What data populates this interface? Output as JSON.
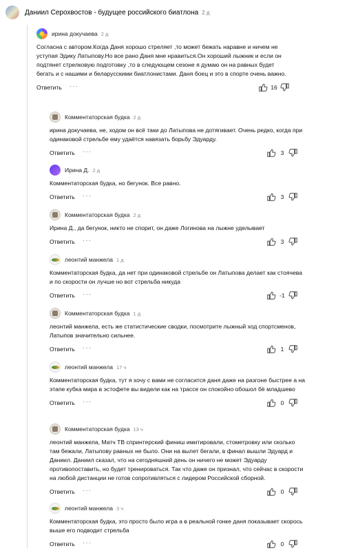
{
  "post": {
    "title": "Даниил Серохвостов - будущее российского биатлона",
    "time": "2 д"
  },
  "comments": [
    {
      "author": "ирина докучаева",
      "time": "2 д",
      "avatar_icon": "colorful-circle-avatar",
      "text": "Согласна с автором.Когда Даня хорошо стреляет ,то может бежать наравне и ничем не уступая Эдику Латыпову.Но все рано Даня мне нравиться.Он хороший лыжник и если он подтянет стрелковую подготовку ,то в следующем сезоне я думаю он на равных будет бегать и с нашими и беларусскими биатлонистами. Даня боец и это в спорте очень важно.",
      "reply": "Ответить",
      "votes": "16"
    },
    {
      "author": "Комментаторская будка",
      "time": "2 д",
      "avatar_icon": "booth-avatar",
      "text": "ирина докучаева, не, ходом он всё таки до Латыпова не дотягивает. Очень редко, когда при одинаковой стрельбе ему удаётся навязать борьбу Эдуарду.",
      "reply": "Ответить",
      "votes": "3"
    },
    {
      "author": "Ирина Д.",
      "time": "2 д",
      "avatar_icon": "purple-avatar",
      "text": "Комментаторская будка, но бегунок. Все равно.",
      "reply": "Ответить",
      "votes": "3"
    },
    {
      "author": "Комментаторская будка",
      "time": "2 д",
      "avatar_icon": "booth-avatar",
      "text": "Ирина Д., да бегунок, никто не спорит, он даже Логинова на лыжне уделывает",
      "reply": "Ответить",
      "votes": "3"
    },
    {
      "author": "леонтий манжела",
      "time": "1 д",
      "avatar_icon": "landscape-avatar",
      "text": "Комментаторская будка, да нет при одинаковой стрельбе он Латыпова делает как стоячева и по скорости он лучше но вот стрельба никуда",
      "reply": "Ответить",
      "votes": "-1"
    },
    {
      "author": "Комментаторская будка",
      "time": "1 д",
      "avatar_icon": "booth-avatar",
      "text": "леонтий манжела, есть же статистические сводки, посмотрите лыжный ход спортсменов, Латыпов значительно сильнее.",
      "reply": "Ответить",
      "votes": "1"
    },
    {
      "author": "леонтий манжела",
      "time": "17 ч",
      "avatar_icon": "landscape-avatar",
      "text": "Комментаторская будка, тут я хочу с вами не согласится даня даже на разгоне быстрее а на этапе кубка мира  в эстофете вы видели как на трассе он спокойно обошол бё младшево",
      "reply": "Ответить",
      "votes": "0"
    },
    {
      "author": "Комментаторская будка",
      "time": "13 ч",
      "avatar_icon": "booth-avatar",
      "text": "леонтий манжела, Матч ТВ спринтерский финиш имитировали, стометровку или сколько там бежали, Латыпову равных не было. Они на вылет бегали, в финал вышли Эдуард и Даниил. Даниил сказал, что на сегодняшний день он ничего не может Эдуарду противопоставить, но будет тренироваться. Так что даже он признал, что сейчас в скорости на любой дистанции не готов сопротивляться с лидером Российской сборной.",
      "reply": "Ответить",
      "votes": "0"
    },
    {
      "author": "леонтий манжела",
      "time": "3 ч",
      "avatar_icon": "landscape-avatar",
      "text": "Комментаторская будка, это просто было игра а в реальной гонке даня показывает скорось выше его подводит стрельба",
      "reply": "Ответить",
      "votes": "0"
    }
  ]
}
